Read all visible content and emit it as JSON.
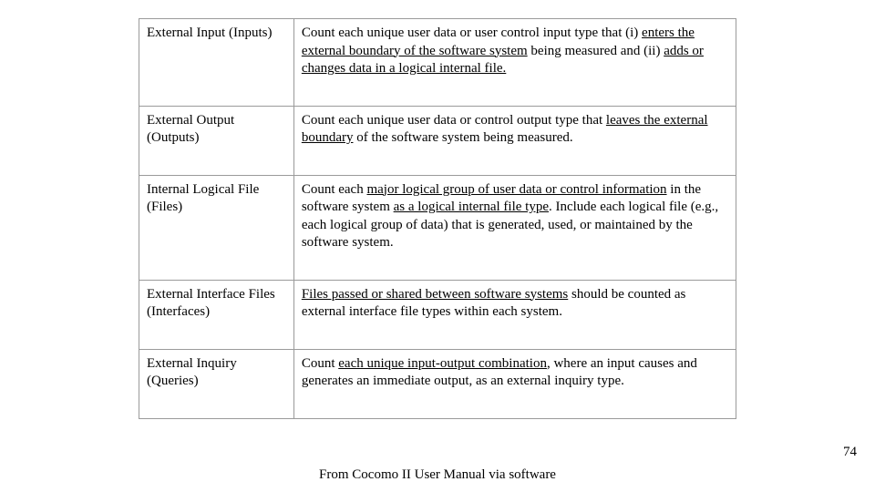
{
  "rows": [
    {
      "label": "External Input (Inputs)",
      "desc": {
        "pre": "Count each unique user data or user control input type that (i) ",
        "u1": "enters the external boundary of the software system",
        "mid1": " being measured and (ii) ",
        "u2": "adds or changes data in a logical internal file.",
        "post": ""
      }
    },
    {
      "label": "External Output (Outputs)",
      "desc": {
        "pre": "Count each unique user data or control output type that ",
        "u1": "leaves the external boundary",
        "mid1": " of the software system being measured.",
        "u2": "",
        "post": ""
      }
    },
    {
      "label": "Internal Logical File (Files)",
      "desc": {
        "pre": "Count each ",
        "u1": "major logical group of user data or control information",
        "mid1": " in the software system ",
        "u2": "as a logical internal file type",
        "post": ". Include each logical file (e.g., each logical group of data) that is generated, used, or maintained by the software system."
      }
    },
    {
      "label": "External Interface Files (Interfaces)",
      "desc": {
        "pre": "",
        "u1": "Files passed or shared between software systems",
        "mid1": " should be counted as external interface file types within each system.",
        "u2": "",
        "post": ""
      }
    },
    {
      "label": "External Inquiry (Queries)",
      "desc": {
        "pre": "Count ",
        "u1": "each unique input-output combination",
        "mid1": ", where an input causes and generates an immediate output, as an external inquiry type.",
        "u2": "",
        "post": ""
      }
    }
  ],
  "caption": "From Cocomo II User Manual via software",
  "page_number": "74"
}
